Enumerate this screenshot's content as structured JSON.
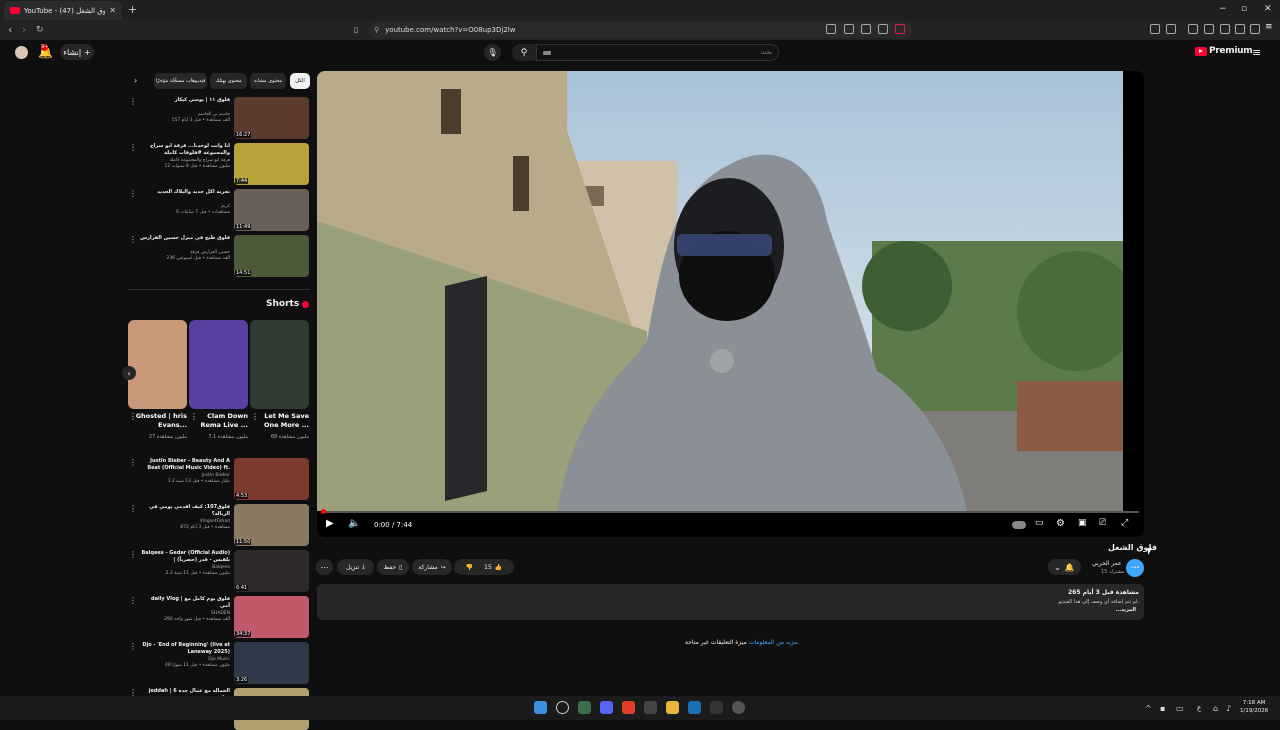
{
  "browser": {
    "tab_title": "YouTube - فلوق الشغل (47)",
    "tab_close": "✕",
    "new_tab": "+",
    "url": "youtube.com/watch?v=O08up3Dj2lw",
    "win_min": "−",
    "win_max": "▫",
    "win_close": "✕"
  },
  "header": {
    "create_label": "إنشاء",
    "search_placeholder": "بحث",
    "notification_count": "9+",
    "logo_text": "Premium"
  },
  "player": {
    "time": "0:00 / 7:44",
    "progress_fraction": 0.0
  },
  "video": {
    "title": "فلوق الشغل",
    "channel": "عمر الحربي",
    "subscribers": "15 مشترك",
    "likes": "15",
    "share": "مشاركة",
    "save": "حفظ",
    "download": "تنزيل",
    "views_date": "265 مشاهدة قبل 3 أيام",
    "description": "لم تتم إضافة أي وصف إلى هذا الفيديو.",
    "more": "...المزيد",
    "comments_off": "ميزة التعليقات غير متاحة.",
    "comments_link": "مزيد من المعلومات"
  },
  "chips": [
    "الكل",
    "محتوى مشابه",
    "محتوى يهمّك",
    "فيديوهات مسجَّلة مؤخرًا"
  ],
  "recommended_top": [
    {
      "title": "فلوق ١١ | يوسي كيكار",
      "channel": "جاسم بن الجاسم",
      "meta": "157 ألف مشاهدة • قبل 3 أيام",
      "duration": "16:27"
    },
    {
      "title": "انا وانت لوحدنا... فرقة ابو سراج والمجموعة #فلوقات كاملة",
      "channel": "فرقة ابو سراج والمجموعة كاملة",
      "meta": "12 مليون مشاهدة • قبل 8 سنوات",
      "duration": "7:44"
    },
    {
      "title": "تجربه اكل جديد والبلاك الجديد",
      "channel": "كريم",
      "meta": "6 مشاهدات • قبل 7 ساعات",
      "duration": "11:49"
    },
    {
      "title": "فلوق طبخ في منزل حسين الفرارس",
      "channel": "حسين الفرارس فرقة",
      "meta": "236 ألف مشاهدة • قبل أسبوعين",
      "duration": "14:51"
    }
  ],
  "shorts": {
    "header": "Shorts",
    "items": [
      {
        "title": "Let Me Save One More ...",
        "views": "68 مليون مشاهدة"
      },
      {
        "title": "Clam Down Rema Live ...",
        "views": "7.1 مليون مشاهدة"
      },
      {
        "title": "Ghosted | hris Evans...",
        "views": "27 مليون مشاهدة"
      }
    ]
  },
  "recommended_bottom": [
    {
      "title": "Justin Bieber - Beauty And A Beat (Official Music Video) ft.",
      "channel": "Justin Bieber",
      "meta": "1.2 مليار مشاهدة • قبل 13 سنة",
      "duration": "4:53"
    },
    {
      "title": "فلوق107: كيف اقدمي يومي في الزبالة؟",
      "channel": "VlogsetFahad",
      "meta": "872 مشاهدة • قبل 3 أيام",
      "duration": "11:50"
    },
    {
      "title": "Balqees - Gedar (Official Audio) | بلقيس - قدر (حصرياً)",
      "channel": "Balqees",
      "meta": "2.3 مليون مشاهدة • قبل 11 سنة",
      "duration": "6:41"
    },
    {
      "title": "daily Vlog | فلوق يوم كامل مع أمي",
      "channel": "SHADEN",
      "meta": "290 ألف مشاهدة • قبل شهر واحد",
      "duration": "34:37"
    },
    {
      "title": "Djo - 'End of Beginning' (live at Laneway 2025)",
      "channel": "Djo Music",
      "meta": "48 مليون مشاهدة • قبل 11 شهرًا",
      "duration": "3:26"
    },
    {
      "title": "jeddah | الحمالة مع عمال جدة 6 دقائق",
      "channel": "",
      "meta": "",
      "duration": ""
    }
  ],
  "taskbar": {
    "time": "7:18 AM",
    "date": "1/19/2026",
    "lang": "ع"
  },
  "colors": {
    "accent_red": "#ff0033",
    "link_blue": "#3ea6ff",
    "bg": "#0f0f0f"
  }
}
